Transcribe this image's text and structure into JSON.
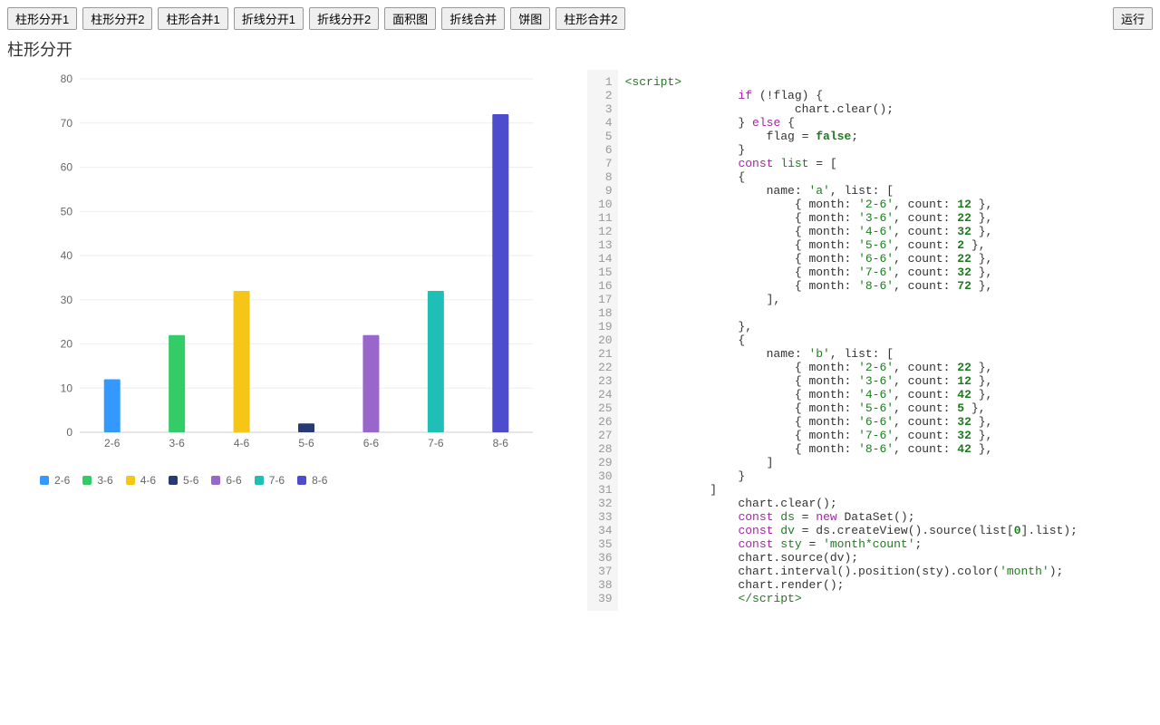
{
  "toolbar": {
    "buttons": [
      "柱形分开1",
      "柱形分开2",
      "柱形合并1",
      "折线分开1",
      "折线分开2",
      "面积图",
      "折线合并",
      "饼图",
      "柱形合并2"
    ],
    "run_label": "运行"
  },
  "title": "柱形分开",
  "chart_data": {
    "type": "bar",
    "categories": [
      "2-6",
      "3-6",
      "4-6",
      "5-6",
      "6-6",
      "7-6",
      "8-6"
    ],
    "values": [
      12,
      22,
      32,
      2,
      22,
      32,
      72
    ],
    "colors": [
      "#3399ff",
      "#33cc66",
      "#f5c518",
      "#273a73",
      "#9966cc",
      "#1fbfb8",
      "#4c4ccc"
    ],
    "ylabel": "",
    "xlabel": "",
    "ylim": [
      0,
      80
    ],
    "yticks": [
      0,
      10,
      20,
      30,
      40,
      50,
      60,
      70,
      80
    ]
  },
  "legend": {
    "items": [
      {
        "label": "2-6",
        "color": "#3399ff"
      },
      {
        "label": "3-6",
        "color": "#33cc66"
      },
      {
        "label": "4-6",
        "color": "#f5c518"
      },
      {
        "label": "5-6",
        "color": "#273a73"
      },
      {
        "label": "6-6",
        "color": "#9966cc"
      },
      {
        "label": "7-6",
        "color": "#1fbfb8"
      },
      {
        "label": "8-6",
        "color": "#4c4ccc"
      }
    ]
  },
  "code": {
    "lines": [
      [
        {
          "t": "<script>",
          "c": "tag"
        }
      ],
      [
        {
          "t": "                if",
          "c": "kw"
        },
        {
          "t": " (!flag) {"
        }
      ],
      [
        {
          "t": "                        chart.clear();"
        }
      ],
      [
        {
          "t": "                } "
        },
        {
          "t": "else",
          "c": "kw"
        },
        {
          "t": " {"
        }
      ],
      [
        {
          "t": "                    flag = "
        },
        {
          "t": "false",
          "c": "bool"
        },
        {
          "t": ";"
        }
      ],
      [
        {
          "t": "                }"
        }
      ],
      [
        {
          "t": "                "
        },
        {
          "t": "const",
          "c": "const"
        },
        {
          "t": " "
        },
        {
          "t": "list",
          "c": "var"
        },
        {
          "t": " = ["
        }
      ],
      [
        {
          "t": "                {"
        }
      ],
      [
        {
          "t": "                    name: "
        },
        {
          "t": "'a'",
          "c": "str"
        },
        {
          "t": ", list: ["
        }
      ],
      [
        {
          "t": "                        { month: "
        },
        {
          "t": "'2-6'",
          "c": "str"
        },
        {
          "t": ", count: "
        },
        {
          "t": "12",
          "c": "num"
        },
        {
          "t": " },"
        }
      ],
      [
        {
          "t": "                        { month: "
        },
        {
          "t": "'3-6'",
          "c": "str"
        },
        {
          "t": ", count: "
        },
        {
          "t": "22",
          "c": "num"
        },
        {
          "t": " },"
        }
      ],
      [
        {
          "t": "                        { month: "
        },
        {
          "t": "'4-6'",
          "c": "str"
        },
        {
          "t": ", count: "
        },
        {
          "t": "32",
          "c": "num"
        },
        {
          "t": " },"
        }
      ],
      [
        {
          "t": "                        { month: "
        },
        {
          "t": "'5-6'",
          "c": "str"
        },
        {
          "t": ", count: "
        },
        {
          "t": "2",
          "c": "num"
        },
        {
          "t": " },"
        }
      ],
      [
        {
          "t": "                        { month: "
        },
        {
          "t": "'6-6'",
          "c": "str"
        },
        {
          "t": ", count: "
        },
        {
          "t": "22",
          "c": "num"
        },
        {
          "t": " },"
        }
      ],
      [
        {
          "t": "                        { month: "
        },
        {
          "t": "'7-6'",
          "c": "str"
        },
        {
          "t": ", count: "
        },
        {
          "t": "32",
          "c": "num"
        },
        {
          "t": " },"
        }
      ],
      [
        {
          "t": "                        { month: "
        },
        {
          "t": "'8-6'",
          "c": "str"
        },
        {
          "t": ", count: "
        },
        {
          "t": "72",
          "c": "num"
        },
        {
          "t": " },"
        }
      ],
      [
        {
          "t": "                    ],"
        }
      ],
      [
        {
          "t": ""
        }
      ],
      [
        {
          "t": "                },"
        }
      ],
      [
        {
          "t": "                {"
        }
      ],
      [
        {
          "t": "                    name: "
        },
        {
          "t": "'b'",
          "c": "str"
        },
        {
          "t": ", list: ["
        }
      ],
      [
        {
          "t": "                        { month: "
        },
        {
          "t": "'2-6'",
          "c": "str"
        },
        {
          "t": ", count: "
        },
        {
          "t": "22",
          "c": "num"
        },
        {
          "t": " },"
        }
      ],
      [
        {
          "t": "                        { month: "
        },
        {
          "t": "'3-6'",
          "c": "str"
        },
        {
          "t": ", count: "
        },
        {
          "t": "12",
          "c": "num"
        },
        {
          "t": " },"
        }
      ],
      [
        {
          "t": "                        { month: "
        },
        {
          "t": "'4-6'",
          "c": "str"
        },
        {
          "t": ", count: "
        },
        {
          "t": "42",
          "c": "num"
        },
        {
          "t": " },"
        }
      ],
      [
        {
          "t": "                        { month: "
        },
        {
          "t": "'5-6'",
          "c": "str"
        },
        {
          "t": ", count: "
        },
        {
          "t": "5",
          "c": "num"
        },
        {
          "t": " },"
        }
      ],
      [
        {
          "t": "                        { month: "
        },
        {
          "t": "'6-6'",
          "c": "str"
        },
        {
          "t": ", count: "
        },
        {
          "t": "32",
          "c": "num"
        },
        {
          "t": " },"
        }
      ],
      [
        {
          "t": "                        { month: "
        },
        {
          "t": "'7-6'",
          "c": "str"
        },
        {
          "t": ", count: "
        },
        {
          "t": "32",
          "c": "num"
        },
        {
          "t": " },"
        }
      ],
      [
        {
          "t": "                        { month: "
        },
        {
          "t": "'8-6'",
          "c": "str"
        },
        {
          "t": ", count: "
        },
        {
          "t": "42",
          "c": "num"
        },
        {
          "t": " },"
        }
      ],
      [
        {
          "t": "                    ]"
        }
      ],
      [
        {
          "t": "                }"
        }
      ],
      [
        {
          "t": "            ]"
        }
      ],
      [
        {
          "t": "                chart.clear();"
        }
      ],
      [
        {
          "t": "                "
        },
        {
          "t": "const",
          "c": "const"
        },
        {
          "t": " "
        },
        {
          "t": "ds",
          "c": "var"
        },
        {
          "t": " = "
        },
        {
          "t": "new",
          "c": "kw"
        },
        {
          "t": " DataSet();"
        }
      ],
      [
        {
          "t": "                "
        },
        {
          "t": "const",
          "c": "const"
        },
        {
          "t": " "
        },
        {
          "t": "dv",
          "c": "var"
        },
        {
          "t": " = ds.createView().source(list["
        },
        {
          "t": "0",
          "c": "num"
        },
        {
          "t": "].list);"
        }
      ],
      [
        {
          "t": "                "
        },
        {
          "t": "const",
          "c": "const"
        },
        {
          "t": " "
        },
        {
          "t": "sty",
          "c": "var"
        },
        {
          "t": " = "
        },
        {
          "t": "'month*count'",
          "c": "str"
        },
        {
          "t": ";"
        }
      ],
      [
        {
          "t": "                chart.source(dv);"
        }
      ],
      [
        {
          "t": "                chart.interval().position(sty).color("
        },
        {
          "t": "'month'",
          "c": "str"
        },
        {
          "t": ");"
        }
      ],
      [
        {
          "t": "                chart.render();"
        }
      ],
      [
        {
          "t": "                "
        },
        {
          "t": "</script>",
          "c": "tag"
        }
      ]
    ]
  }
}
